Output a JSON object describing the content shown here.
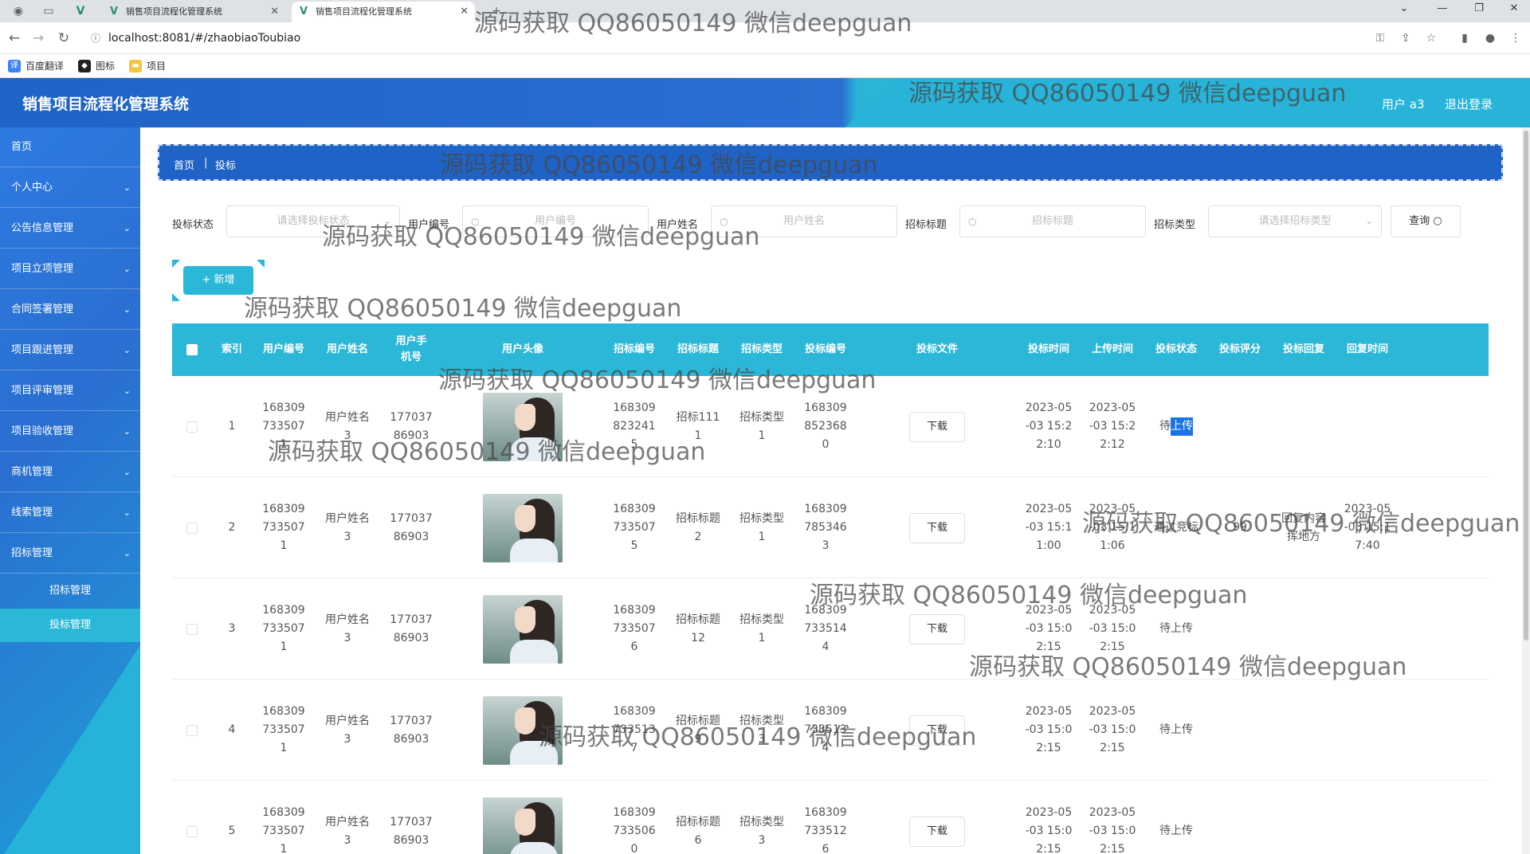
{
  "browser": {
    "tabs": [
      {
        "title": "销售项目流程化管理系统"
      },
      {
        "title": "销售项目流程化管理系统"
      }
    ],
    "url": "localhost:8081/#/zhaobiaoToubiao",
    "bookmarks": [
      "百度翻译",
      "图标",
      "项目"
    ]
  },
  "header": {
    "title": "销售项目流程化管理系统",
    "user": "用户 a3",
    "logout": "退出登录"
  },
  "sidebar": {
    "items": [
      {
        "label": "首页"
      },
      {
        "label": "个人中心"
      },
      {
        "label": "公告信息管理"
      },
      {
        "label": "项目立项管理"
      },
      {
        "label": "合同签署管理"
      },
      {
        "label": "项目跟进管理"
      },
      {
        "label": "项目评审管理"
      },
      {
        "label": "项目验收管理"
      },
      {
        "label": "商机管理"
      },
      {
        "label": "线索管理"
      },
      {
        "label": "招标管理"
      }
    ],
    "sub_items": [
      {
        "label": "招标管理"
      },
      {
        "label": "投标管理"
      }
    ]
  },
  "breadcrumb": {
    "home": "首页",
    "sep": "|",
    "current": "投标"
  },
  "search": {
    "status_label": "投标状态",
    "status_placeholder": "请选择投标状态",
    "userno_label": "用户编号",
    "userno_placeholder": "用户编号",
    "username_label": "用户姓名",
    "username_placeholder": "用户姓名",
    "title_label": "招标标题",
    "title_placeholder": "招标标题",
    "type_label": "招标类型",
    "type_placeholder": "请选择招标类型",
    "query_button": "查询"
  },
  "toolbar": {
    "add_button": "+ 新增"
  },
  "table": {
    "columns": [
      "索引",
      "用户编号",
      "用户姓名",
      "用户手机号",
      "用户头像",
      "招标编号",
      "招标标题",
      "招标类型",
      "投标编号",
      "投标文件",
      "投标时间",
      "上传时间",
      "投标状态",
      "投标评分",
      "投标回复",
      "回复时间"
    ],
    "download_label": "下载",
    "rows": [
      {
        "index": "1",
        "user_no": "1683097335071",
        "user_name": "用户姓名3",
        "phone": "17703786903",
        "bid_no": "1683098232415",
        "bid_title": "招标1111",
        "bid_type": "招标类型1",
        "tender_no": "1683098523680",
        "tender_time": "2023-05-03 15:22:10",
        "upload_time": "2023-05-03 15:22:12",
        "status_pre": "待",
        "status_sel": "上传",
        "score": "",
        "reply": "",
        "reply_time": ""
      },
      {
        "index": "2",
        "user_no": "1683097335071",
        "user_name": "用户姓名3",
        "phone": "17703786903",
        "bid_no": "1683097335075",
        "bid_title": "招标标题2",
        "bid_type": "招标类型1",
        "tender_no": "1683097853463",
        "tender_time": "2023-05-03 15:11:00",
        "upload_time": "2023-05-03 15:11:06",
        "status_pre": "通过竞标",
        "status_sel": "",
        "score": "99",
        "reply": "回复内容挥地方",
        "reply_time": "2023-05-03 15:17:40"
      },
      {
        "index": "3",
        "user_no": "1683097335071",
        "user_name": "用户姓名3",
        "phone": "17703786903",
        "bid_no": "1683097335076",
        "bid_title": "招标标题12",
        "bid_type": "招标类型1",
        "tender_no": "1683097335144",
        "tender_time": "2023-05-03 15:02:15",
        "upload_time": "2023-05-03 15:02:15",
        "status_pre": "待上传",
        "status_sel": "",
        "score": "",
        "reply": "",
        "reply_time": ""
      },
      {
        "index": "4",
        "user_no": "1683097335071",
        "user_name": "用户姓名3",
        "phone": "17703786903",
        "bid_no": "1683097335137",
        "bid_title": "招标标题9",
        "bid_type": "招标类型3",
        "tender_no": "1683097335134",
        "tender_time": "2023-05-03 15:02:15",
        "upload_time": "2023-05-03 15:02:15",
        "status_pre": "待上传",
        "status_sel": "",
        "score": "",
        "reply": "",
        "reply_time": ""
      },
      {
        "index": "5",
        "user_no": "1683097335071",
        "user_name": "用户姓名3",
        "phone": "17703786903",
        "bid_no": "1683097335060",
        "bid_title": "招标标题6",
        "bid_type": "招标类型3",
        "tender_no": "1683097335126",
        "tender_time": "2023-05-03 15:02:15",
        "upload_time": "2023-05-03 15:02:15",
        "status_pre": "待上传",
        "status_sel": "",
        "score": "",
        "reply": "",
        "reply_time": ""
      }
    ]
  },
  "watermark": "源码获取 QQ86050149 微信deepguan",
  "colors": {
    "primary": "#2a6fd1",
    "accent": "#2bb8d8"
  }
}
